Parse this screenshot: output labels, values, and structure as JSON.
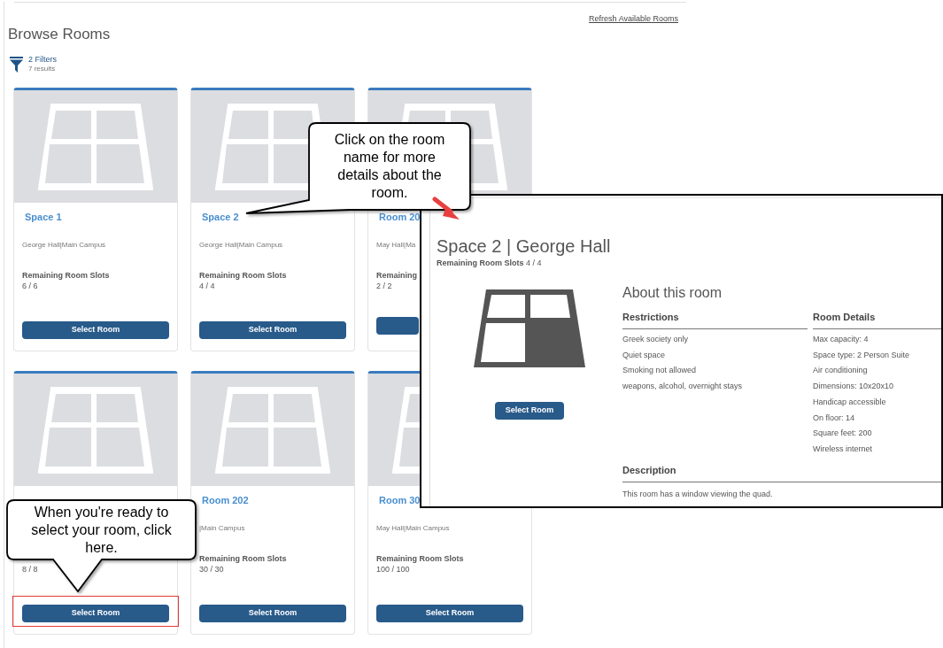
{
  "page": {
    "title": "Browse Rooms",
    "refresh_link": "Refresh Available Rooms",
    "filters": {
      "label": "2 Filters",
      "results": "7 results"
    }
  },
  "rooms": [
    {
      "title": "Space 1",
      "location": "George Hall|Main Campus",
      "slots_label": "Remaining Room Slots",
      "slots": "6 / 6",
      "button": "Select Room",
      "highlighted": false
    },
    {
      "title": "Space 2",
      "location": "George Hall|Main Campus",
      "slots_label": "Remaining Room Slots",
      "slots": "4 / 4",
      "button": "Select Room",
      "highlighted": false
    },
    {
      "title": "Room 20",
      "location": "May Hall|Ma",
      "slots_label": "Remaining",
      "slots": "2 / 2",
      "highlighted": false
    },
    {
      "slots": "8 / 8",
      "button": "Select Room",
      "highlighted": true
    },
    {
      "title": "Room 202",
      "location": "|Main Campus",
      "slots_label": "Remaining Room Slots",
      "slots": "30 / 30",
      "button": "Select Room",
      "highlighted": false
    },
    {
      "title": "Room 30",
      "location": "May Hall|Main Campus",
      "slots_label": "Remaining Room Slots",
      "slots": "100 / 100",
      "button": "Select Room",
      "highlighted": false
    }
  ],
  "detail": {
    "title": "Space 2 | George Hall",
    "slots_label": "Remaining Room Slots",
    "slots": "4 / 4",
    "button": "Select Room",
    "about_heading": "About this room",
    "restrictions": {
      "heading": "Restrictions",
      "items": [
        "Greek society only",
        "Quiet space",
        "Smoking not allowed",
        "weapons, alcohol, overnight stays"
      ]
    },
    "room_details": {
      "heading": "Room Details",
      "items": [
        "Max capacity: 4",
        "Space type: 2 Person Suite",
        "Air conditioning",
        "Dimensions: 10x20x10",
        "Handicap accessible",
        "On floor: 14",
        "Square feet: 200",
        "Wireless internet"
      ]
    },
    "description": {
      "heading": "Description",
      "text": "This room has a window viewing the quad."
    }
  },
  "callouts": [
    {
      "text": "Click on the room name for more details about the room."
    },
    {
      "text": "When you're ready to select your room, click here."
    }
  ]
}
